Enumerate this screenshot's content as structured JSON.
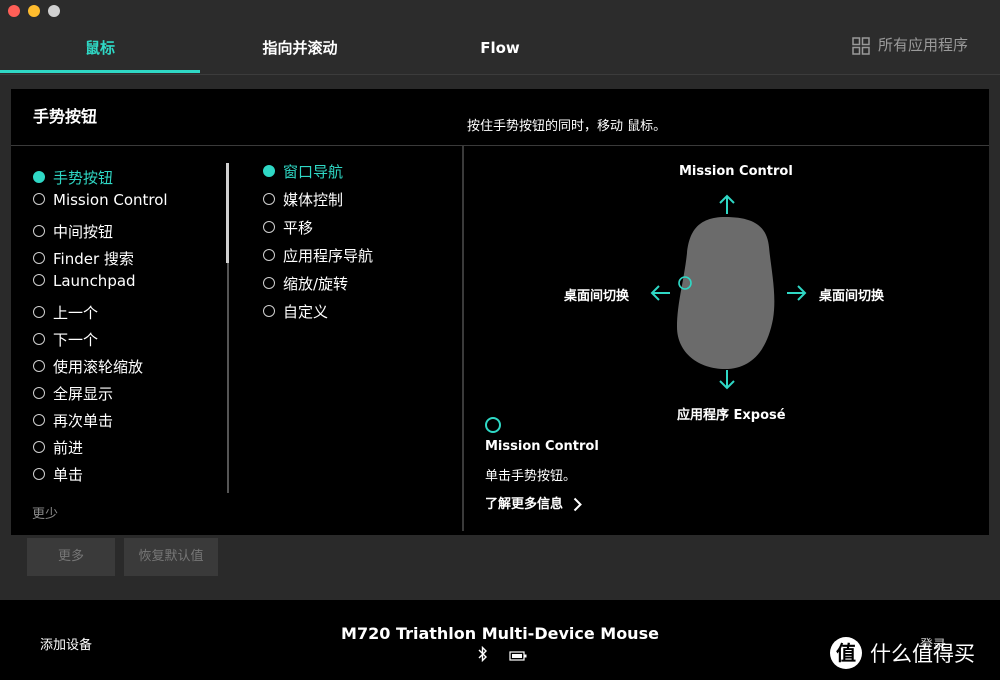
{
  "window": {
    "traffic_lights": [
      "#fe5f57",
      "#febc2e",
      "#d0d0d0"
    ]
  },
  "nav": {
    "tabs": [
      "鼠标",
      "指向并滚动",
      "Flow"
    ],
    "all_apps": "所有应用程序",
    "accent": "#2fd8c5"
  },
  "panel": {
    "title": "手势按钮",
    "instruction": "按住手势按钮的同时，移动 鼠标。",
    "left_options": [
      "手势按钮",
      "Mission Control",
      "中间按钮",
      "Finder 搜索",
      "Launchpad",
      "上一个",
      "下一个",
      "使用滚轮缩放",
      "全屏显示",
      "再次单击",
      "前进",
      "单击"
    ],
    "less": "更少",
    "right_options": [
      "窗口导航",
      "媒体控制",
      "平移",
      "应用程序导航",
      "缩放/旋转",
      "自定义"
    ],
    "mouse": {
      "up": "Mission Control",
      "left": "桌面间切换",
      "right": "桌面间切换",
      "down": "应用程序 Exposé"
    },
    "action": {
      "name": "Mission Control",
      "desc": "单击手势按钮。",
      "learn_more": "了解更多信息"
    }
  },
  "buttons": {
    "more": "更多",
    "reset": "恢复默认值"
  },
  "footer": {
    "add_device": "添加设备",
    "device": "M720 Triathlon Multi-Device Mouse",
    "login": "登录",
    "watermark_logo": "值",
    "watermark": "什么值得买"
  }
}
